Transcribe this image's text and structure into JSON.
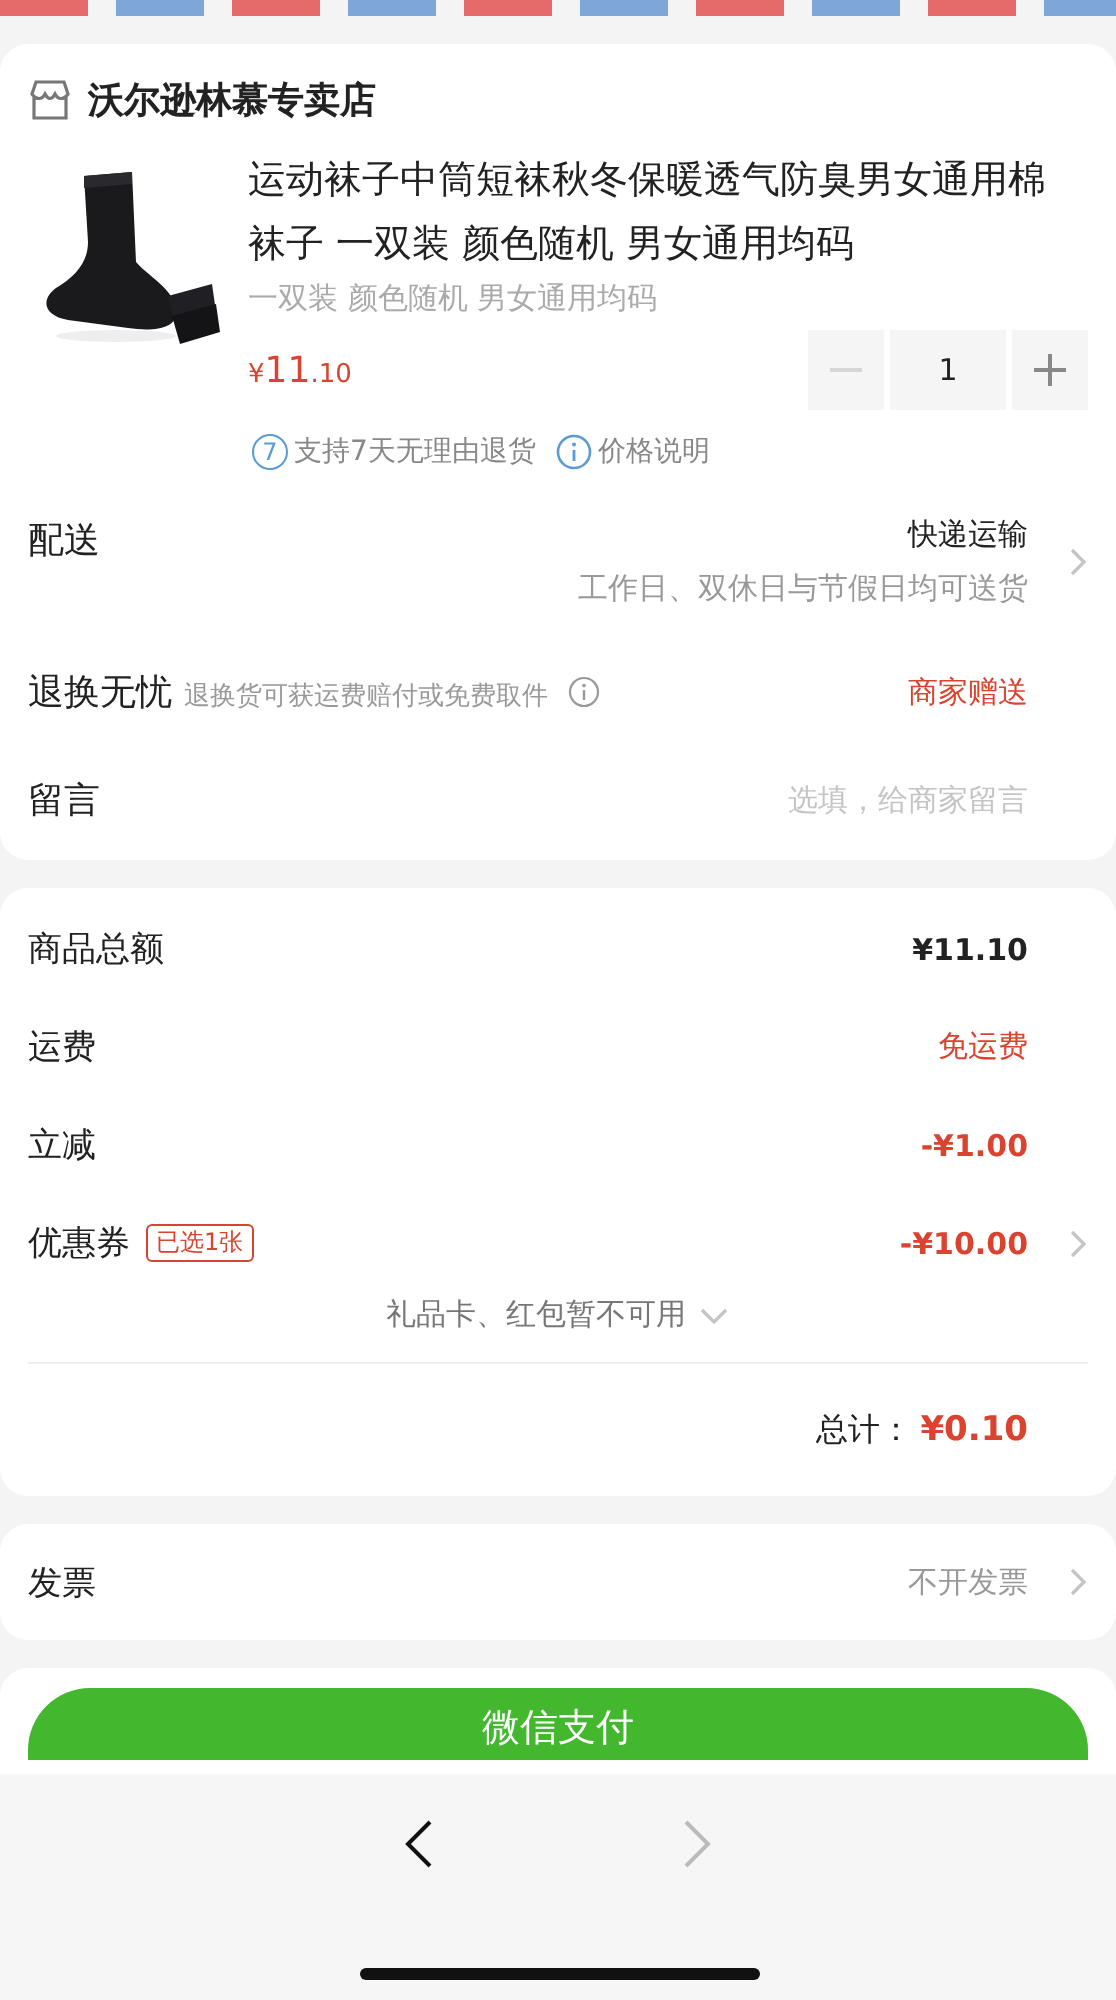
{
  "store": {
    "name": "沃尔逊林慕专卖店"
  },
  "product": {
    "title": "运动袜子中筒短袜秋冬保暖透气防臭男女通用棉袜子 一双装 颜色随机 男女通用均码",
    "spec": "一双装 颜色随机 男女通用均码",
    "price": {
      "currency": "¥",
      "integer": "11",
      "decimal": ".10"
    },
    "quantity": "1",
    "decrease_disabled": true,
    "increase_disabled": false,
    "badges": [
      {
        "kind": "number",
        "icon": "7",
        "text": "支持7天无理由退货"
      },
      {
        "kind": "info",
        "text": "价格说明"
      }
    ]
  },
  "options": [
    {
      "kind": "delivery",
      "label": "配送",
      "value": "快递运输",
      "note": "工作日、双休日与节假日均可送货",
      "arrow": true
    },
    {
      "kind": "service",
      "label": "退换无忧",
      "hint": "退换货可获运费赔付或免费取件",
      "value": "商家赠送",
      "arrow": false
    },
    {
      "kind": "message",
      "label": "留言",
      "placeholder": "选填，给商家留言",
      "arrow": false
    }
  ],
  "summary": {
    "rows": [
      {
        "label": "商品总额",
        "value": "¥11.10",
        "kind": "amount",
        "highlight": false,
        "arrow": false
      },
      {
        "label": "运费",
        "value": "免运费",
        "kind": "text",
        "highlight": true,
        "arrow": false
      },
      {
        "label": "立减",
        "value": "-¥1.00",
        "kind": "amount",
        "highlight": true,
        "arrow": false
      },
      {
        "label": "优惠券",
        "tag": "已选1张",
        "value": "-¥10.00",
        "kind": "amount",
        "highlight": true,
        "arrow": true
      }
    ],
    "notice": "礼品卡、红包暂不可用",
    "total_label": "总计：",
    "total": "¥0.10"
  },
  "invoice": {
    "label": "发票",
    "value": "不开发票",
    "arrow": true
  },
  "pay_button": "微信支付",
  "browser": {
    "back_disabled": false,
    "forward_disabled": true
  }
}
